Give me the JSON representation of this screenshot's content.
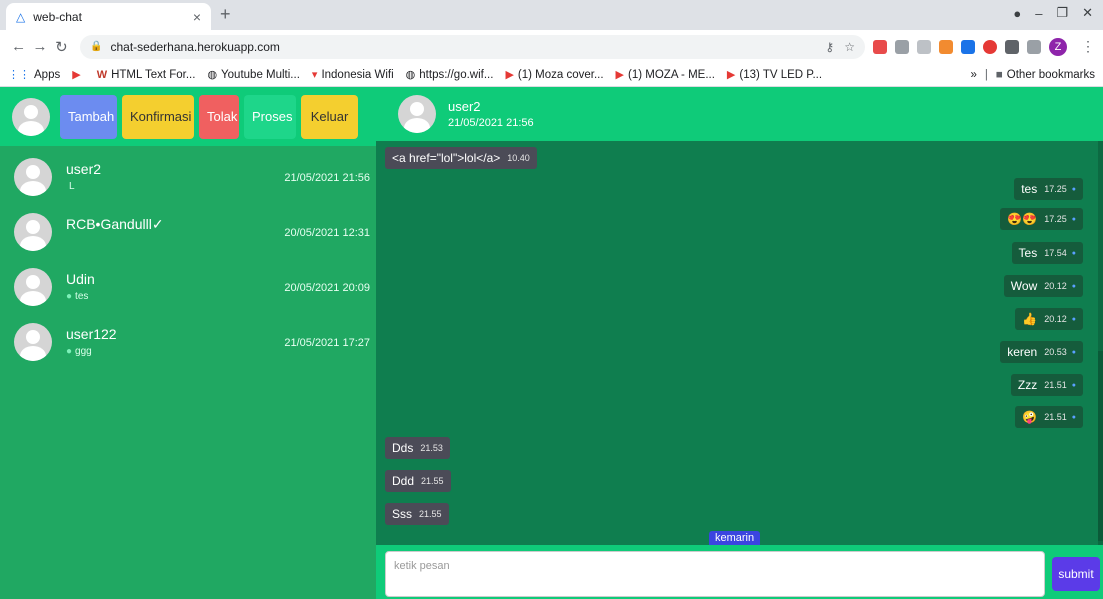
{
  "browser": {
    "tab_title": "web-chat",
    "tab_close": "×",
    "new_tab": "+",
    "url": "chat-sederhana.herokuapp.com",
    "profile_initial": "Z",
    "bookmarks": [
      {
        "label": "Apps",
        "icon": "apps-grid-icon"
      },
      {
        "label": "",
        "icon": "youtube-icon"
      },
      {
        "label": "HTML Text For...",
        "icon": "w-icon"
      },
      {
        "label": "Youtube Multi...",
        "icon": "globe-icon"
      },
      {
        "label": "Indonesia Wifi",
        "icon": "wifi-icon"
      },
      {
        "label": "https://go.wif...",
        "icon": "globe-icon"
      },
      {
        "label": "(1) Moza cover...",
        "icon": "youtube-icon"
      },
      {
        "label": "(1) MOZA - ME...",
        "icon": "youtube-icon"
      },
      {
        "label": "(13) TV LED P...",
        "icon": "youtube-icon"
      }
    ],
    "more_bookmarks": "»",
    "other_bookmarks": "Other bookmarks"
  },
  "sidebar": {
    "buttons": {
      "tambah": "Tambah",
      "konfirmasi": "Konfirmasi",
      "tolak": "Tolak",
      "proses": "Proses",
      "keluar": "Keluar"
    },
    "contacts": [
      {
        "name": "user2",
        "last": "L",
        "dot": "",
        "time": "21/05/2021 21:56"
      },
      {
        "name": "RCB•Gandulll✓",
        "last": "",
        "dot": "",
        "time": "20/05/2021 12:31"
      },
      {
        "name": "Udin",
        "last": "tes",
        "dot": "●",
        "time": "20/05/2021 20:09"
      },
      {
        "name": "user122",
        "last": "ggg",
        "dot": "●",
        "time": "21/05/2021 17:27"
      }
    ]
  },
  "chat": {
    "header": {
      "name": "user2",
      "date": "21/05/2021 21:56"
    },
    "messages": [
      {
        "side": "in",
        "text": "<a href=\"lol\">lol</a>",
        "time": "10.40"
      },
      {
        "side": "out",
        "text": "tes",
        "time": "17.25"
      },
      {
        "side": "out",
        "text": "😍😍",
        "time": "17.25"
      },
      {
        "side": "out",
        "text": "Tes",
        "time": "17.54"
      },
      {
        "side": "out",
        "text": "Wow",
        "time": "20.12"
      },
      {
        "side": "out",
        "text": "👍",
        "time": "20.12"
      },
      {
        "side": "out",
        "text": "keren",
        "time": "20.53"
      },
      {
        "side": "out",
        "text": "Zzz",
        "time": "21.51"
      },
      {
        "side": "out",
        "text": "🤪",
        "time": "21.51"
      },
      {
        "side": "in",
        "text": "Dds",
        "time": "21.53"
      },
      {
        "side": "in",
        "text": "Ddd",
        "time": "21.55"
      },
      {
        "side": "in",
        "text": "Sss",
        "time": "21.55"
      }
    ],
    "tick": "●",
    "day_separator": "kemarin",
    "compose": {
      "placeholder": "ketik pesan",
      "submit": "submit"
    }
  }
}
